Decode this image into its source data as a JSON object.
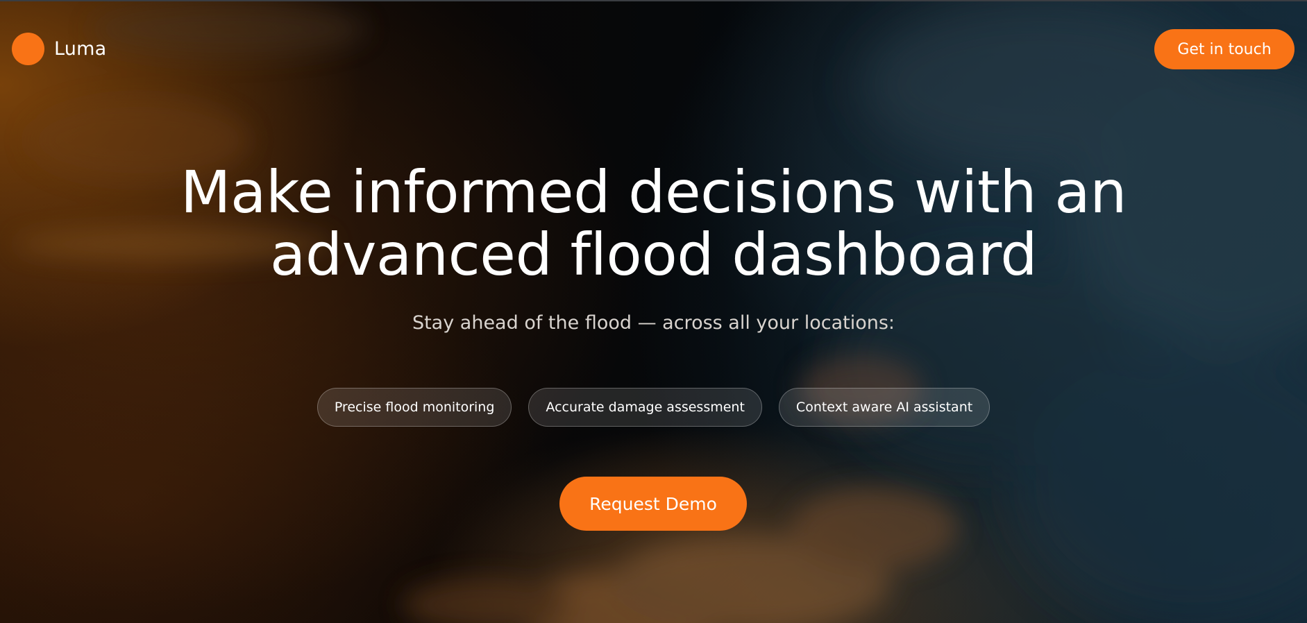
{
  "brand": {
    "name": "Luma",
    "accent_color": "#f97316"
  },
  "header": {
    "cta_label": "Get in touch"
  },
  "hero": {
    "headline_line1": "Make informed decisions with an",
    "headline_line2": "advanced flood dashboard",
    "subheadline": "Stay ahead of the flood — across all your locations:",
    "features": [
      {
        "label": "Precise flood monitoring"
      },
      {
        "label": "Accurate damage assessment"
      },
      {
        "label": "Context aware AI assistant"
      }
    ],
    "cta_label": "Request Demo"
  }
}
